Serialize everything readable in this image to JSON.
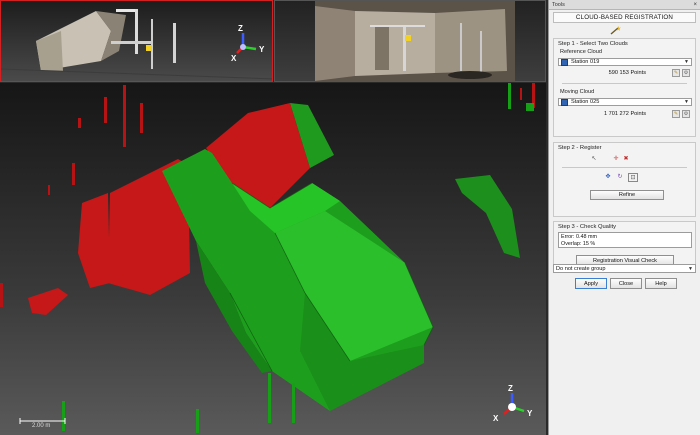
{
  "viewports": {
    "top_left": {
      "axes": {
        "z": "Z",
        "x": "X",
        "y": "Y"
      }
    },
    "top_right": {},
    "main": {
      "scale": "2.00 m",
      "axes": {
        "z": "Z",
        "x": "X",
        "y": "Y"
      }
    }
  },
  "panel": {
    "window_title": "Tools",
    "close_glyph": "×",
    "title": "CLOUD-BASED REGISTRATION",
    "step1": {
      "title": "Step 1 - Select Two Clouds",
      "reference_label": "Reference Cloud",
      "reference_value": "Station 019",
      "reference_points": "590 153  Points",
      "moving_label": "Moving Cloud",
      "moving_value": "Station 025",
      "moving_points": "1 701 272  Points"
    },
    "step2": {
      "title": "Step 2 - Register",
      "refine_label": "Refine"
    },
    "step3": {
      "title": "Step 3 - Check Quality",
      "error_text": "Error: 0.48 mm",
      "overlap_text": "Overlap: 15 %",
      "visual_check_label": "Registration Visual Check"
    },
    "group_select": "Do not create group",
    "buttons": {
      "apply": "Apply",
      "close": "Close",
      "help": "Help"
    }
  },
  "colors": {
    "reference_cloud": "#d41c1c",
    "moving_cloud": "#22b422",
    "panel_bg": "#f0f0f0"
  }
}
